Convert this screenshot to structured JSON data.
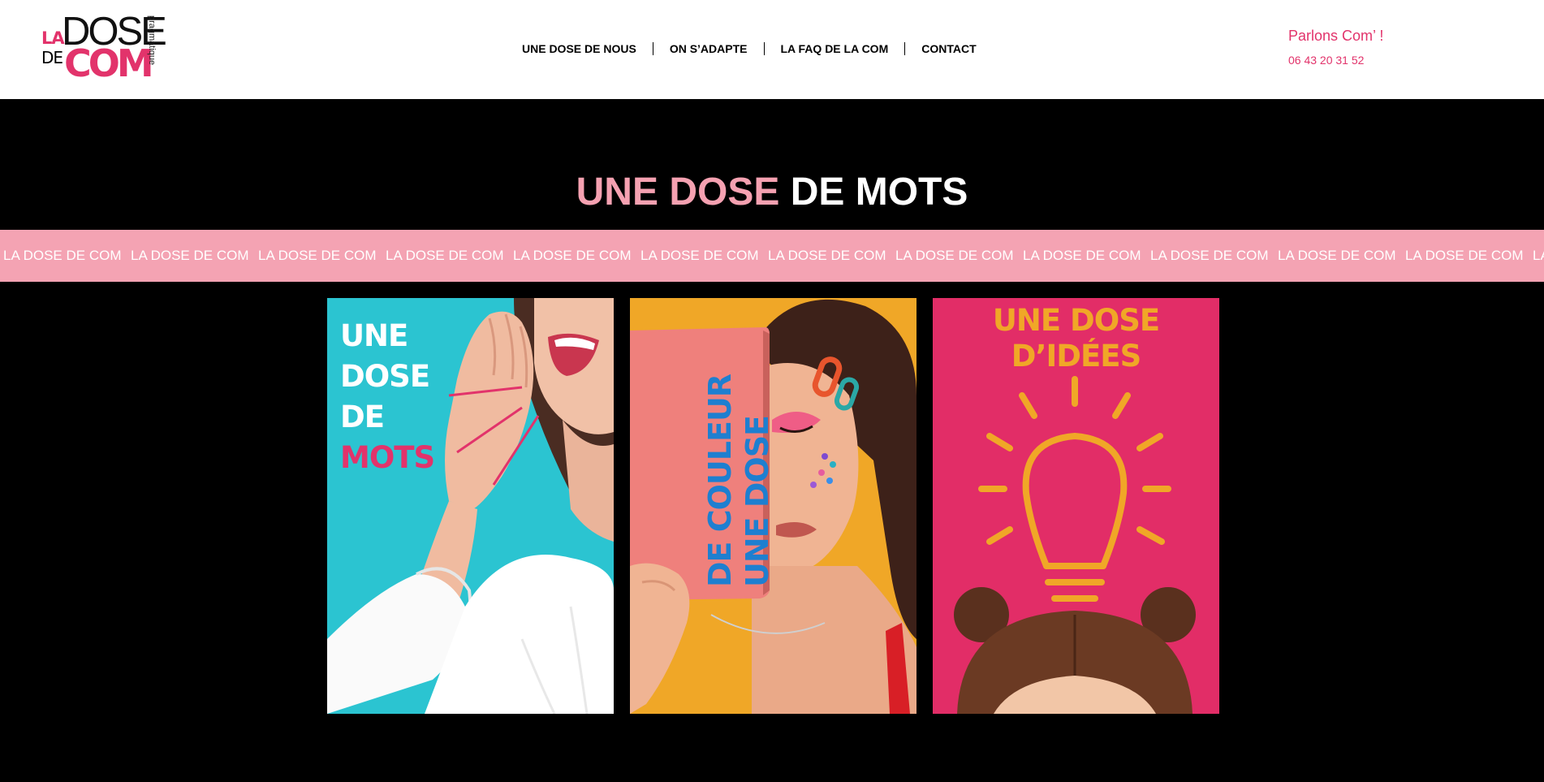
{
  "brand": {
    "logo_la": "LA",
    "logo_de": "DE",
    "logo_dose": "DOSE",
    "logo_com": "COM",
    "logo_tagline": "pragmatique",
    "accent_color": "#e2336b",
    "light_pink": "#f4a3b3"
  },
  "nav": {
    "items": [
      {
        "label": "UNE DOSE DE NOUS"
      },
      {
        "label": "ON S’ADAPTE"
      },
      {
        "label": "LA FAQ DE LA COM"
      },
      {
        "label": "CONTACT"
      }
    ]
  },
  "contact": {
    "title": "Parlons Com’ !",
    "phone": "06 43 20 31 52"
  },
  "hero": {
    "title_light": "UNE DOSE ",
    "title_bold": "DE MOTS"
  },
  "marquee": {
    "text": "LA DOSE DE COM",
    "repeat": 13
  },
  "cards": [
    {
      "name": "mots",
      "lines": [
        "UNE",
        "DOSE",
        "DE"
      ],
      "highlight": "MOTS",
      "bg": "#2bc4d1"
    },
    {
      "name": "couleur",
      "lines": [
        "UNE DOSE",
        "DE COULEUR"
      ],
      "bg": "#f0a727"
    },
    {
      "name": "idees",
      "lines": [
        "UNE DOSE",
        "D’IDÉES"
      ],
      "bg": "#e22d67"
    }
  ]
}
